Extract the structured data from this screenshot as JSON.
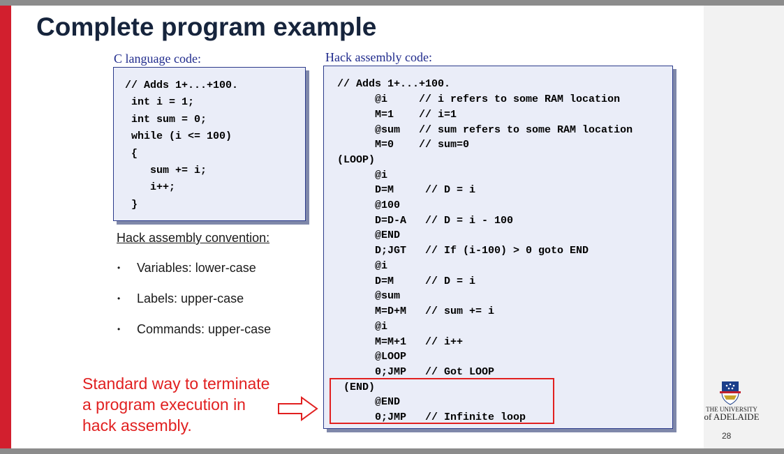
{
  "slide": {
    "title": "Complete program example",
    "page_number": "28"
  },
  "c_code": {
    "caption": "C language code:",
    "lines": [
      "// Adds 1+...+100.",
      " int i = 1;",
      " int sum = 0;",
      " while (i <= 100)",
      " {",
      "    sum += i;",
      "    i++;",
      " }"
    ]
  },
  "hack_code": {
    "caption": "Hack assembly code:",
    "lines": [
      "// Adds 1+...+100.",
      "      @i     // i refers to some RAM location",
      "      M=1    // i=1",
      "      @sum   // sum refers to some RAM location",
      "      M=0    // sum=0",
      "(LOOP)",
      "      @i",
      "      D=M     // D = i",
      "      @100",
      "      D=D-A   // D = i - 100",
      "      @END",
      "      D;JGT   // If (i-100) > 0 goto END",
      "      @i",
      "      D=M     // D = i",
      "      @sum",
      "      M=D+M   // sum += i",
      "      @i",
      "      M=M+1   // i++",
      "      @LOOP",
      "      0;JMP   // Got LOOP",
      " (END)",
      "      @END",
      "      0;JMP   // Infinite loop"
    ]
  },
  "convention": {
    "title": "Hack assembly convention:",
    "bullets": [
      "Variables: lower-case",
      "Labels: upper-case",
      "Commands: upper-case"
    ]
  },
  "note": {
    "lines": [
      "Standard way to terminate",
      "a program execution in",
      "hack assembly."
    ]
  },
  "university": {
    "line1": "THE UNIVERSITY",
    "line2": "of ADELAIDE"
  },
  "colors": {
    "accent_red": "#d21f2e",
    "title_navy": "#16243c",
    "note_red": "#e12020",
    "code_bg": "#eaedf8"
  }
}
